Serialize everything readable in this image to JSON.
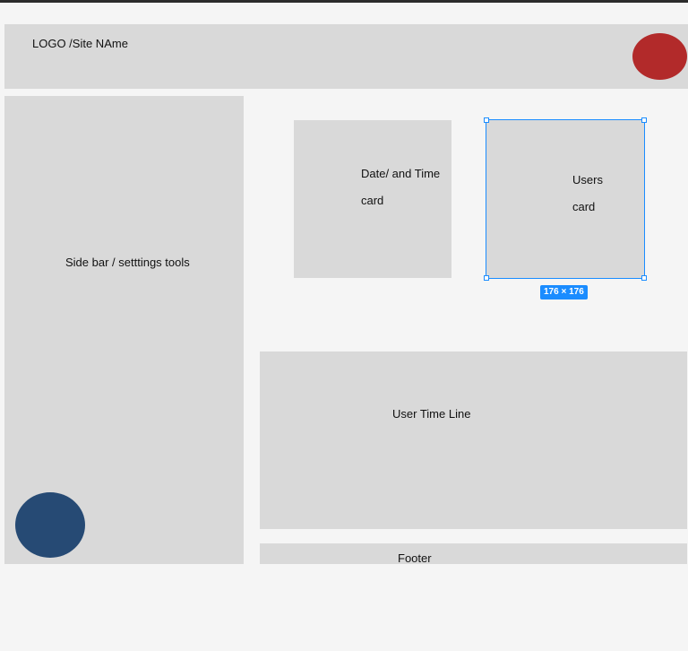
{
  "header": {
    "logo_text": "LOGO /Site NAme"
  },
  "sidebar": {
    "label": "Side bar / setttings tools"
  },
  "date_card": {
    "line1": "Date/ and Time",
    "line2": "card"
  },
  "users_card": {
    "line1": "Users",
    "line2": "card"
  },
  "selection": {
    "size_label": "176 × 176"
  },
  "timeline": {
    "label": "User Time Line"
  },
  "footer": {
    "label": "Footer"
  },
  "colors": {
    "background": "#f5f5f5",
    "block": "#d9d9d9",
    "avatar_red": "#b22a2a",
    "circle_blue": "#264a74",
    "selection_blue": "#1a8cff"
  }
}
